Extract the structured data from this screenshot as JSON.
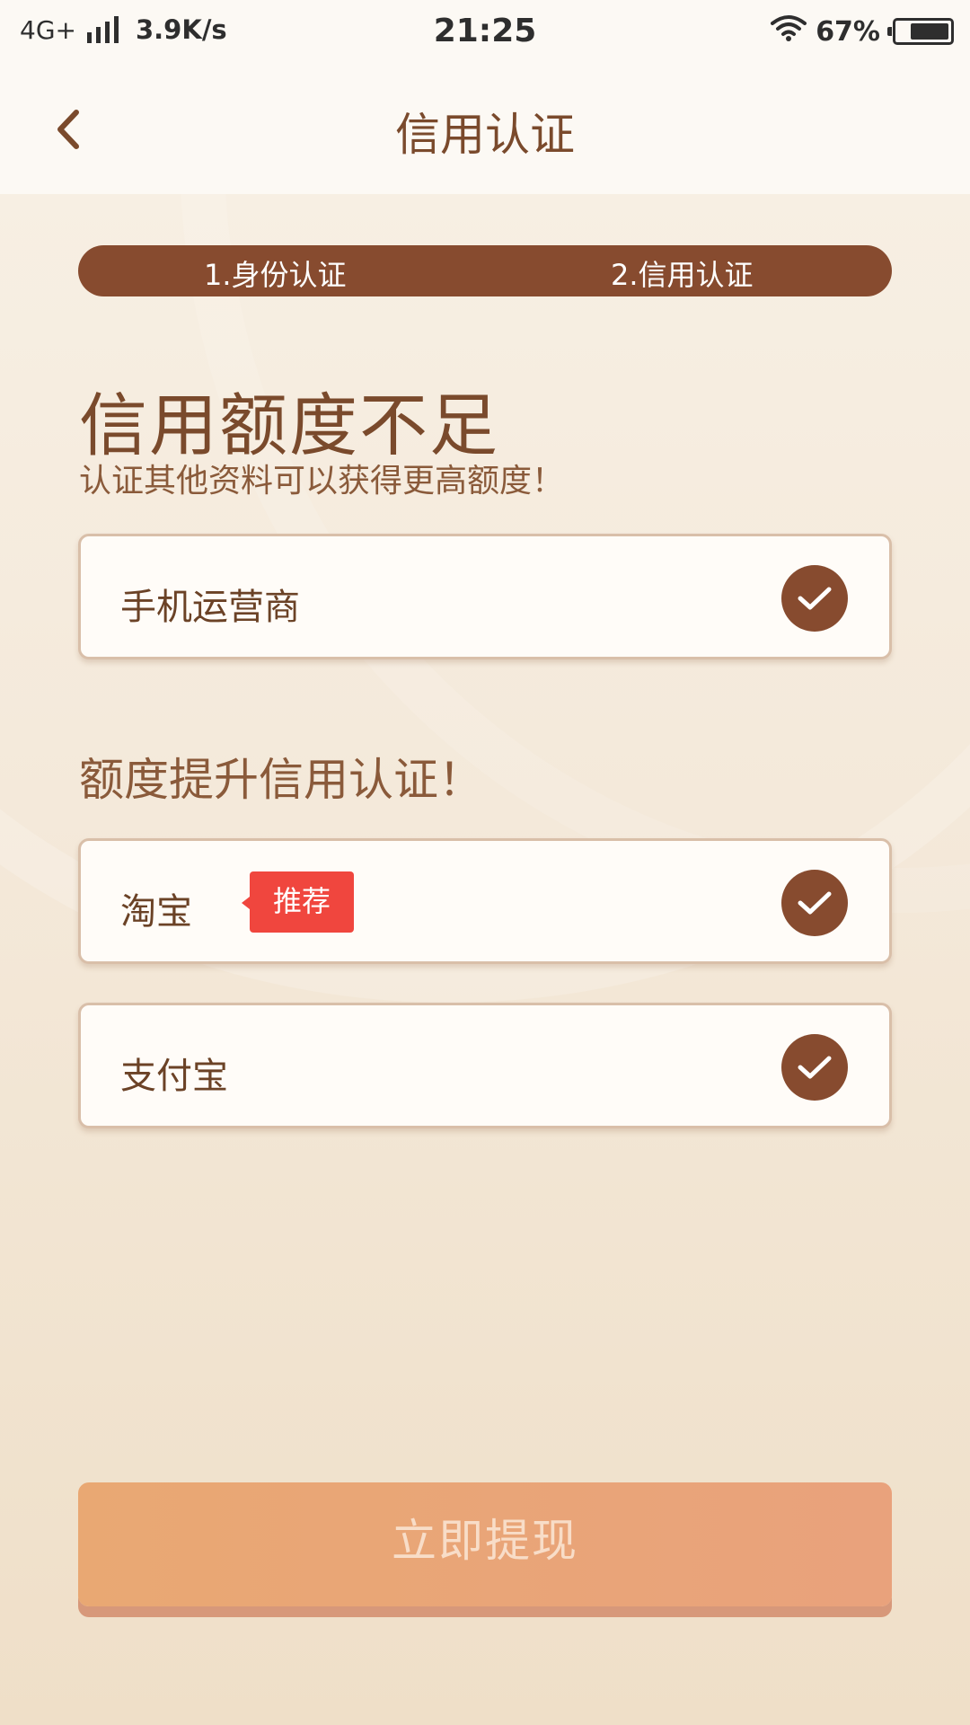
{
  "status_bar": {
    "network": "4G+",
    "speed": "3.9K/s",
    "time": "21:25",
    "battery": "67%"
  },
  "nav": {
    "title": "信用认证"
  },
  "steps": [
    {
      "label": "1.身份认证"
    },
    {
      "label": "2.信用认证"
    }
  ],
  "main": {
    "headline": "信用额度不足",
    "subline": "认证其他资料可以获得更高额度！",
    "required_items": [
      {
        "label": "手机运营商",
        "checked": true
      }
    ],
    "section_title": "额度提升信用认证！",
    "boost_items": [
      {
        "label": "淘宝",
        "badge": "推荐",
        "checked": true
      },
      {
        "label": "支付宝",
        "checked": true
      }
    ],
    "submit_label": "立即提现"
  },
  "colors": {
    "brand_brown": "#874b2f",
    "badge_red": "#f0463e",
    "button_orange": "#e9a873"
  },
  "icons": {
    "back": "chevron-left-icon",
    "check": "check-circle-icon",
    "wifi": "wifi-icon",
    "battery": "battery-icon",
    "signal": "signal-icon"
  }
}
